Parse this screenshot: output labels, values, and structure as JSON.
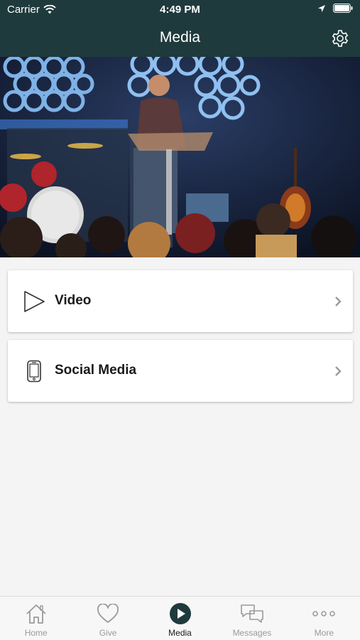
{
  "status": {
    "carrier": "Carrier",
    "time": "4:49 PM"
  },
  "header": {
    "title": "Media"
  },
  "hero": {
    "alt_icon": "sermon-photo"
  },
  "menu": [
    {
      "label": "Video",
      "icon": "play-icon"
    },
    {
      "label": "Social Media",
      "icon": "phone-icon"
    }
  ],
  "tabs": [
    {
      "label": "Home",
      "icon": "home-icon"
    },
    {
      "label": "Give",
      "icon": "heart-icon"
    },
    {
      "label": "Media",
      "icon": "play-circle-icon",
      "active": true
    },
    {
      "label": "Messages",
      "icon": "chat-icon"
    },
    {
      "label": "More",
      "icon": "more-icon"
    }
  ],
  "colors": {
    "header_bg": "#1f3a3d",
    "accent": "#1f3a3d",
    "tab_inactive": "#9a9a9a"
  }
}
